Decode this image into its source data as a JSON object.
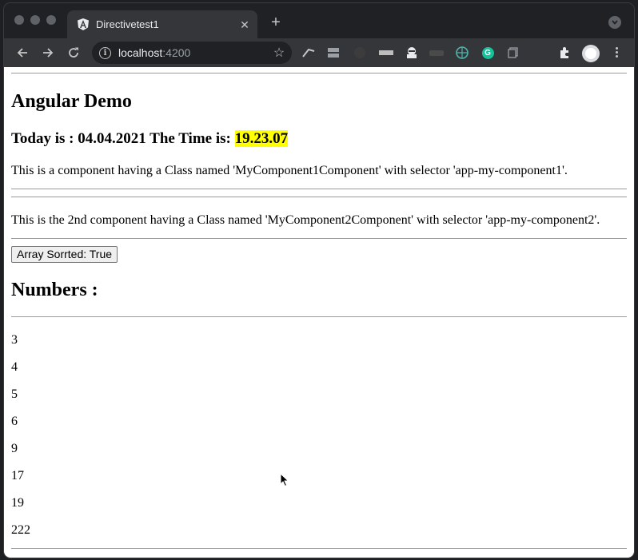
{
  "browser": {
    "tab_title": "Directivetest1",
    "url_host": "localhost",
    "url_port": ":4200"
  },
  "page": {
    "heading": "Angular Demo",
    "date_prefix": "Today is : 04.04.2021 The Time is: ",
    "time": "19.23.07",
    "component1_text": "This is a component having a Class named 'MyComponent1Component' with selector 'app-my-component1'.",
    "component2_text": "This is the 2nd component having a Class named 'MyComponent2Component' with selector 'app-my-component2'.",
    "sort_button_label": "Array Sorrted: True",
    "numbers_heading": "Numbers :",
    "numbers": [
      "3",
      "4",
      "5",
      "6",
      "9",
      "17",
      "19",
      "222"
    ]
  }
}
